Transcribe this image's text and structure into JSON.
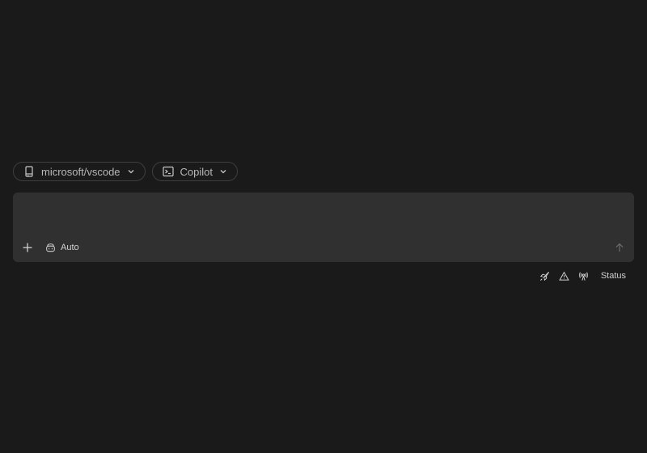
{
  "selectors": {
    "repo": {
      "label": "microsoft/vscode",
      "icon": "repo-icon"
    },
    "agent": {
      "label": "Copilot",
      "icon": "terminal-icon"
    }
  },
  "composer": {
    "placeholder": "",
    "value": "",
    "mode_label": "Auto",
    "mode_icon": "copilot-icon",
    "add_icon": "plus-icon",
    "send_icon": "arrow-up-icon"
  },
  "status_bar": {
    "icons": [
      "rocket-icon",
      "warning-icon",
      "broadcast-icon"
    ],
    "status_label": "Status"
  },
  "colors": {
    "background": "#1a1a1a",
    "composer_bg": "#303030",
    "pill_border": "#3f3f3f",
    "text": "#cccccc"
  }
}
